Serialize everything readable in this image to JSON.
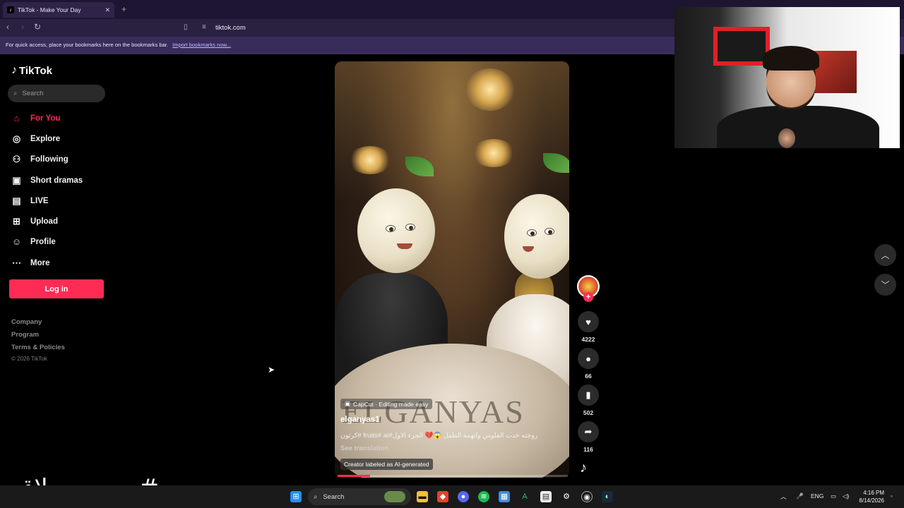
{
  "browser": {
    "tab_title": "TikTok - Make Your Day",
    "tab_close": "✕",
    "new_tab": "+",
    "url": "tiktok.com",
    "bookmarks_msg": "For quick access, place your bookmarks here on the bookmarks bar.",
    "bookmarks_link": "Import bookmarks now..."
  },
  "sidebar": {
    "logo": "TikTok",
    "search_placeholder": "Search",
    "items": [
      {
        "label": "For You",
        "icon": "home-icon",
        "active": true
      },
      {
        "label": "Explore",
        "icon": "compass-icon"
      },
      {
        "label": "Following",
        "icon": "following-icon"
      },
      {
        "label": "Short dramas",
        "icon": "film-icon"
      },
      {
        "label": "LIVE",
        "icon": "live-icon"
      },
      {
        "label": "Upload",
        "icon": "upload-icon"
      },
      {
        "label": "Profile",
        "icon": "profile-icon"
      },
      {
        "label": "More",
        "icon": "more-icon"
      }
    ],
    "login": "Log in",
    "footer": [
      "Company",
      "Program",
      "Terms & Policies"
    ],
    "copyright": "© 2026 TikTok"
  },
  "video": {
    "watermark": "ELGANYAS",
    "capcut": "CapCut · Editing made easy",
    "author": "elganyas1",
    "caption": "كرتون# fruits# ai#روجته خدت الفلوس واتهمة الطفل 😱💔 الجزء الاول",
    "see_translation": "See translation",
    "ai_label": "Creator labeled as AI-generated",
    "progress": 0.14
  },
  "actions": {
    "likes": "4222",
    "comments": "66",
    "saves": "502",
    "shares": "116"
  },
  "overlay_text": "#مصمم_حلاق",
  "taskbar": {
    "search": "Search",
    "lang": "ENG",
    "time": "4:16 PM",
    "date": "8/14/2026"
  }
}
